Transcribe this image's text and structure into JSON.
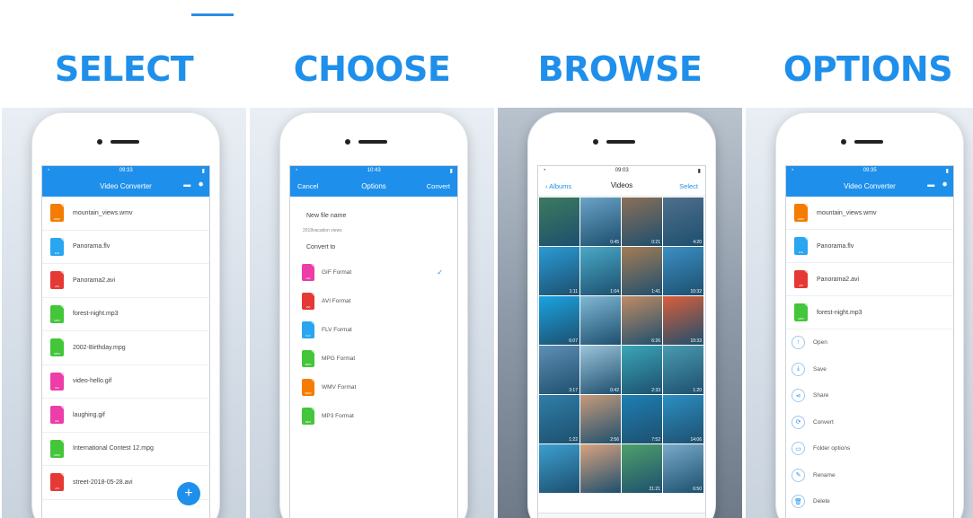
{
  "headings": [
    "SELECT",
    "CHOOSE",
    "BROWSE",
    "OPTIONS"
  ],
  "select_screen": {
    "time": "09:33",
    "title": "Video Converter",
    "files": [
      {
        "name": "mountain_views.wmv",
        "color": "#f57c00",
        "ext": "WMV"
      },
      {
        "name": "Panorama.flv",
        "color": "#29a6ef",
        "ext": "FLV"
      },
      {
        "name": "Panorama2.avi",
        "color": "#e53935",
        "ext": "AVI"
      },
      {
        "name": "forest-night.mp3",
        "color": "#43c63a",
        "ext": "MP3"
      },
      {
        "name": "2002-Birthday.mpg",
        "color": "#43c63a",
        "ext": "MPG"
      },
      {
        "name": "video-hello.gif",
        "color": "#ec3da8",
        "ext": "GIF"
      },
      {
        "name": "laughing.gif",
        "color": "#ec3da8",
        "ext": "GIF"
      },
      {
        "name": "International Contest 12.mpg",
        "color": "#43c63a",
        "ext": "MPG"
      },
      {
        "name": "street-2018-05-28.avi",
        "color": "#e53935",
        "ext": "AVI"
      }
    ],
    "fab": "+"
  },
  "choose_screen": {
    "time": "10:43",
    "cancel": "Cancel",
    "title": "Options",
    "convert": "Convert",
    "new_file_label": "New file name",
    "file_name_value": "2018vacation views",
    "convert_to_label": "Convert to",
    "formats": [
      {
        "name": "GIF Format",
        "color": "#ec3da8",
        "ext": "GIF",
        "selected": "✓"
      },
      {
        "name": "AVI Format",
        "color": "#e53935",
        "ext": "AVI"
      },
      {
        "name": "FLV Format",
        "color": "#29a6ef",
        "ext": "FLV"
      },
      {
        "name": "MPG Format",
        "color": "#43c63a",
        "ext": "MPG"
      },
      {
        "name": "WMV Format",
        "color": "#f57c00",
        "ext": "WMV"
      },
      {
        "name": "MP3 Format",
        "color": "#43c63a",
        "ext": "MP3"
      }
    ]
  },
  "browse_screen": {
    "time": "09:03",
    "back": "Albums",
    "title": "Videos",
    "select": "Select",
    "durations": [
      "",
      "0:45",
      "0:21",
      "4:20",
      "1:11",
      "1:04",
      "1:41",
      "10:32",
      "6:07",
      "",
      "6:26",
      "10:33",
      "3:17",
      "0:42",
      "2:33",
      "1:20",
      "1:22",
      "2:56",
      "7:52",
      "14:06",
      "",
      "",
      "21:21",
      "6:50"
    ],
    "thumb_colors": [
      "#3d7a5e",
      "#6aa2c7",
      "#8b6f57",
      "#4f6f8c",
      "#2a9bd6",
      "#49a9c7",
      "#a57c55",
      "#3b8fc5",
      "#1aa3e0",
      "#7fb8d4",
      "#c08a62",
      "#d95e3a",
      "#5f8fb5",
      "#9cc3da",
      "#3aa6b8",
      "#4a9bb0",
      "#2f7ea8",
      "#c79a7a",
      "#1e7fb3",
      "#2c8fc4",
      "#3c9fcf",
      "#d8a27e",
      "#4fa06a",
      "#78a9c9"
    ],
    "tab_active": "Albums"
  },
  "options_screen": {
    "time": "09:35",
    "title": "Video Converter",
    "files": [
      {
        "name": "mountain_views.wmv",
        "color": "#f57c00",
        "ext": "WMV"
      },
      {
        "name": "Panorama.flv",
        "color": "#29a6ef",
        "ext": "FLV"
      },
      {
        "name": "Panorama2.avi",
        "color": "#e53935",
        "ext": "AVI"
      },
      {
        "name": "forest-night.mp3",
        "color": "#43c63a",
        "ext": "MP3"
      }
    ],
    "actions": [
      {
        "label": "Open",
        "icon": "open-icon",
        "glyph": "↑"
      },
      {
        "label": "Save",
        "icon": "save-icon",
        "glyph": "⤓"
      },
      {
        "label": "Share",
        "icon": "share-icon",
        "glyph": "⋖"
      },
      {
        "label": "Convert",
        "icon": "convert-icon",
        "glyph": "⟳"
      },
      {
        "label": "Folder options",
        "icon": "folder-icon",
        "glyph": "▭"
      },
      {
        "label": "Rename",
        "icon": "rename-icon",
        "glyph": "✎"
      },
      {
        "label": "Delete",
        "icon": "delete-icon",
        "glyph": "🗑"
      }
    ]
  }
}
